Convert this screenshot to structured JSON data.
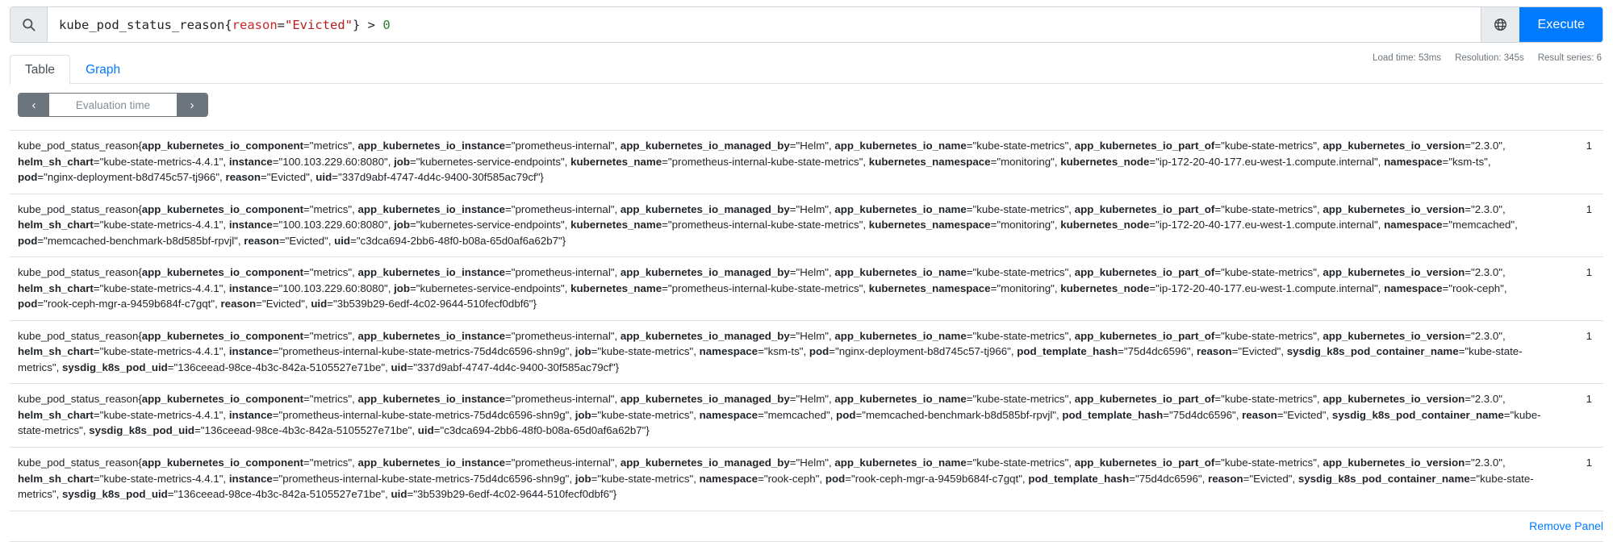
{
  "query_bar": {
    "search_icon": "search-icon",
    "globe_icon": "globe-icon",
    "execute_label": "Execute",
    "expression": "kube_pod_status_reason{reason=\"Evicted\"} > 0",
    "tokens": {
      "metric": "kube_pod_status_reason",
      "open_brace": "{",
      "label_key": "reason",
      "equals": "=",
      "label_value": "\"Evicted\"",
      "close_brace": "}",
      "operator": " > ",
      "number": "0"
    }
  },
  "tabs": [
    {
      "label": "Table",
      "active": true
    },
    {
      "label": "Graph",
      "active": false
    }
  ],
  "stats": {
    "load_time": "Load time: 53ms",
    "resolution": "Resolution: 345s",
    "result_series": "Result series: 6"
  },
  "evaluation_time": {
    "prev_label": "‹",
    "next_label": "›",
    "placeholder": "Evaluation time",
    "value": ""
  },
  "results": {
    "metric_name": "kube_pod_status_reason",
    "rows": [
      {
        "value": "1",
        "labels": [
          {
            "key": "app_kubernetes_io_component",
            "value": "\"metrics\""
          },
          {
            "key": "app_kubernetes_io_instance",
            "value": "\"prometheus-internal\""
          },
          {
            "key": "app_kubernetes_io_managed_by",
            "value": "\"Helm\""
          },
          {
            "key": "app_kubernetes_io_name",
            "value": "\"kube-state-metrics\""
          },
          {
            "key": "app_kubernetes_io_part_of",
            "value": "\"kube-state-metrics\""
          },
          {
            "key": "app_kubernetes_io_version",
            "value": "\"2.3.0\""
          },
          {
            "key": "helm_sh_chart",
            "value": "\"kube-state-metrics-4.4.1\""
          },
          {
            "key": "instance",
            "value": "\"100.103.229.60:8080\""
          },
          {
            "key": "job",
            "value": "\"kubernetes-service-endpoints\""
          },
          {
            "key": "kubernetes_name",
            "value": "\"prometheus-internal-kube-state-metrics\""
          },
          {
            "key": "kubernetes_namespace",
            "value": "\"monitoring\""
          },
          {
            "key": "kubernetes_node",
            "value": "\"ip-172-20-40-177.eu-west-1.compute.internal\""
          },
          {
            "key": "namespace",
            "value": "\"ksm-ts\""
          },
          {
            "key": "pod",
            "value": "\"nginx-deployment-b8d745c57-tj966\""
          },
          {
            "key": "reason",
            "value": "\"Evicted\""
          },
          {
            "key": "uid",
            "value": "\"337d9abf-4747-4d4c-9400-30f585ac79cf\""
          }
        ]
      },
      {
        "value": "1",
        "labels": [
          {
            "key": "app_kubernetes_io_component",
            "value": "\"metrics\""
          },
          {
            "key": "app_kubernetes_io_instance",
            "value": "\"prometheus-internal\""
          },
          {
            "key": "app_kubernetes_io_managed_by",
            "value": "\"Helm\""
          },
          {
            "key": "app_kubernetes_io_name",
            "value": "\"kube-state-metrics\""
          },
          {
            "key": "app_kubernetes_io_part_of",
            "value": "\"kube-state-metrics\""
          },
          {
            "key": "app_kubernetes_io_version",
            "value": "\"2.3.0\""
          },
          {
            "key": "helm_sh_chart",
            "value": "\"kube-state-metrics-4.4.1\""
          },
          {
            "key": "instance",
            "value": "\"100.103.229.60:8080\""
          },
          {
            "key": "job",
            "value": "\"kubernetes-service-endpoints\""
          },
          {
            "key": "kubernetes_name",
            "value": "\"prometheus-internal-kube-state-metrics\""
          },
          {
            "key": "kubernetes_namespace",
            "value": "\"monitoring\""
          },
          {
            "key": "kubernetes_node",
            "value": "\"ip-172-20-40-177.eu-west-1.compute.internal\""
          },
          {
            "key": "namespace",
            "value": "\"memcached\""
          },
          {
            "key": "pod",
            "value": "\"memcached-benchmark-b8d585bf-rpvjl\""
          },
          {
            "key": "reason",
            "value": "\"Evicted\""
          },
          {
            "key": "uid",
            "value": "\"c3dca694-2bb6-48f0-b08a-65d0af6a62b7\""
          }
        ]
      },
      {
        "value": "1",
        "labels": [
          {
            "key": "app_kubernetes_io_component",
            "value": "\"metrics\""
          },
          {
            "key": "app_kubernetes_io_instance",
            "value": "\"prometheus-internal\""
          },
          {
            "key": "app_kubernetes_io_managed_by",
            "value": "\"Helm\""
          },
          {
            "key": "app_kubernetes_io_name",
            "value": "\"kube-state-metrics\""
          },
          {
            "key": "app_kubernetes_io_part_of",
            "value": "\"kube-state-metrics\""
          },
          {
            "key": "app_kubernetes_io_version",
            "value": "\"2.3.0\""
          },
          {
            "key": "helm_sh_chart",
            "value": "\"kube-state-metrics-4.4.1\""
          },
          {
            "key": "instance",
            "value": "\"100.103.229.60:8080\""
          },
          {
            "key": "job",
            "value": "\"kubernetes-service-endpoints\""
          },
          {
            "key": "kubernetes_name",
            "value": "\"prometheus-internal-kube-state-metrics\""
          },
          {
            "key": "kubernetes_namespace",
            "value": "\"monitoring\""
          },
          {
            "key": "kubernetes_node",
            "value": "\"ip-172-20-40-177.eu-west-1.compute.internal\""
          },
          {
            "key": "namespace",
            "value": "\"rook-ceph\""
          },
          {
            "key": "pod",
            "value": "\"rook-ceph-mgr-a-9459b684f-c7gqt\""
          },
          {
            "key": "reason",
            "value": "\"Evicted\""
          },
          {
            "key": "uid",
            "value": "\"3b539b29-6edf-4c02-9644-510fecf0dbf6\""
          }
        ]
      },
      {
        "value": "1",
        "labels": [
          {
            "key": "app_kubernetes_io_component",
            "value": "\"metrics\""
          },
          {
            "key": "app_kubernetes_io_instance",
            "value": "\"prometheus-internal\""
          },
          {
            "key": "app_kubernetes_io_managed_by",
            "value": "\"Helm\""
          },
          {
            "key": "app_kubernetes_io_name",
            "value": "\"kube-state-metrics\""
          },
          {
            "key": "app_kubernetes_io_part_of",
            "value": "\"kube-state-metrics\""
          },
          {
            "key": "app_kubernetes_io_version",
            "value": "\"2.3.0\""
          },
          {
            "key": "helm_sh_chart",
            "value": "\"kube-state-metrics-4.4.1\""
          },
          {
            "key": "instance",
            "value": "\"prometheus-internal-kube-state-metrics-75d4dc6596-shn9g\""
          },
          {
            "key": "job",
            "value": "\"kube-state-metrics\""
          },
          {
            "key": "namespace",
            "value": "\"ksm-ts\""
          },
          {
            "key": "pod",
            "value": "\"nginx-deployment-b8d745c57-tj966\""
          },
          {
            "key": "pod_template_hash",
            "value": "\"75d4dc6596\""
          },
          {
            "key": "reason",
            "value": "\"Evicted\""
          },
          {
            "key": "sysdig_k8s_pod_container_name",
            "value": "\"kube-state-metrics\""
          },
          {
            "key": "sysdig_k8s_pod_uid",
            "value": "\"136ceead-98ce-4b3c-842a-5105527e71be\""
          },
          {
            "key": "uid",
            "value": "\"337d9abf-4747-4d4c-9400-30f585ac79cf\""
          }
        ]
      },
      {
        "value": "1",
        "labels": [
          {
            "key": "app_kubernetes_io_component",
            "value": "\"metrics\""
          },
          {
            "key": "app_kubernetes_io_instance",
            "value": "\"prometheus-internal\""
          },
          {
            "key": "app_kubernetes_io_managed_by",
            "value": "\"Helm\""
          },
          {
            "key": "app_kubernetes_io_name",
            "value": "\"kube-state-metrics\""
          },
          {
            "key": "app_kubernetes_io_part_of",
            "value": "\"kube-state-metrics\""
          },
          {
            "key": "app_kubernetes_io_version",
            "value": "\"2.3.0\""
          },
          {
            "key": "helm_sh_chart",
            "value": "\"kube-state-metrics-4.4.1\""
          },
          {
            "key": "instance",
            "value": "\"prometheus-internal-kube-state-metrics-75d4dc6596-shn9g\""
          },
          {
            "key": "job",
            "value": "\"kube-state-metrics\""
          },
          {
            "key": "namespace",
            "value": "\"memcached\""
          },
          {
            "key": "pod",
            "value": "\"memcached-benchmark-b8d585bf-rpvjl\""
          },
          {
            "key": "pod_template_hash",
            "value": "\"75d4dc6596\""
          },
          {
            "key": "reason",
            "value": "\"Evicted\""
          },
          {
            "key": "sysdig_k8s_pod_container_name",
            "value": "\"kube-state-metrics\""
          },
          {
            "key": "sysdig_k8s_pod_uid",
            "value": "\"136ceead-98ce-4b3c-842a-5105527e71be\""
          },
          {
            "key": "uid",
            "value": "\"c3dca694-2bb6-48f0-b08a-65d0af6a62b7\""
          }
        ]
      },
      {
        "value": "1",
        "labels": [
          {
            "key": "app_kubernetes_io_component",
            "value": "\"metrics\""
          },
          {
            "key": "app_kubernetes_io_instance",
            "value": "\"prometheus-internal\""
          },
          {
            "key": "app_kubernetes_io_managed_by",
            "value": "\"Helm\""
          },
          {
            "key": "app_kubernetes_io_name",
            "value": "\"kube-state-metrics\""
          },
          {
            "key": "app_kubernetes_io_part_of",
            "value": "\"kube-state-metrics\""
          },
          {
            "key": "app_kubernetes_io_version",
            "value": "\"2.3.0\""
          },
          {
            "key": "helm_sh_chart",
            "value": "\"kube-state-metrics-4.4.1\""
          },
          {
            "key": "instance",
            "value": "\"prometheus-internal-kube-state-metrics-75d4dc6596-shn9g\""
          },
          {
            "key": "job",
            "value": "\"kube-state-metrics\""
          },
          {
            "key": "namespace",
            "value": "\"rook-ceph\""
          },
          {
            "key": "pod",
            "value": "\"rook-ceph-mgr-a-9459b684f-c7gqt\""
          },
          {
            "key": "pod_template_hash",
            "value": "\"75d4dc6596\""
          },
          {
            "key": "reason",
            "value": "\"Evicted\""
          },
          {
            "key": "sysdig_k8s_pod_container_name",
            "value": "\"kube-state-metrics\""
          },
          {
            "key": "sysdig_k8s_pod_uid",
            "value": "\"136ceead-98ce-4b3c-842a-5105527e71be\""
          },
          {
            "key": "uid",
            "value": "\"3b539b29-6edf-4c02-9644-510fecf0dbf6\""
          }
        ]
      }
    ]
  },
  "footer": {
    "remove_panel_label": "Remove Panel"
  },
  "colors": {
    "accent": "#007bff",
    "string_literal": "#b71c1c",
    "number_literal": "#2e7d32",
    "muted": "#6c757d",
    "border": "#dee2e6"
  }
}
